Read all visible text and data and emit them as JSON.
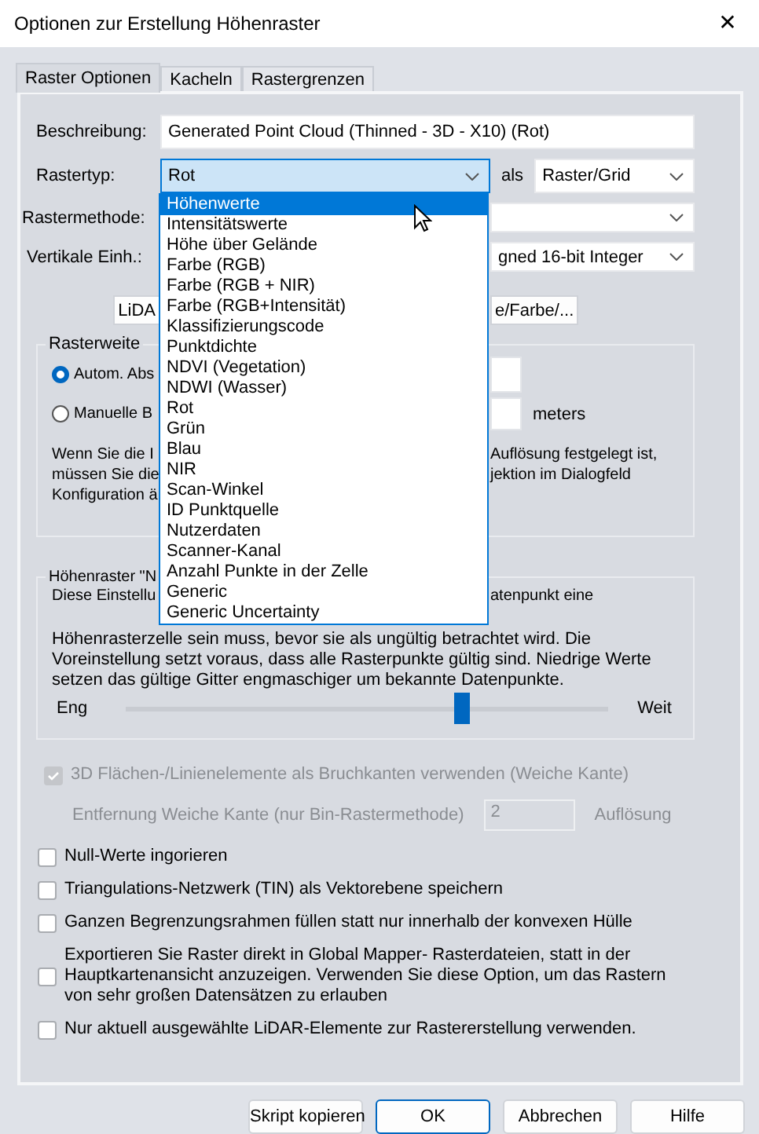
{
  "window": {
    "title": "Optionen zur Erstellung Höhenraster",
    "close": "✕"
  },
  "tabs": [
    {
      "label": "Raster Optionen",
      "selected": true
    },
    {
      "label": "Kacheln",
      "selected": false
    },
    {
      "label": "Rastergrenzen",
      "selected": false
    }
  ],
  "form": {
    "description": {
      "label": "Beschreibung:",
      "value": "Generated Point Cloud (Thinned - 3D - X10) (Rot)"
    },
    "raster_type": {
      "label": "Rastertyp:",
      "value": "Rot",
      "open": true
    },
    "as_label": "als",
    "output_type": {
      "value": "Raster/Grid"
    },
    "method": {
      "label": "Rastermethode:"
    },
    "vertical_units": {
      "label": "Vertikale Einh.:",
      "value": "gned 16-bit Integer"
    }
  },
  "action_buttons": [
    "LiDA",
    "e/Farbe/..."
  ],
  "dropdown": {
    "items": [
      {
        "label": "Höhenwerte",
        "selected": true
      },
      {
        "label": "Intensitätswerte",
        "selected": false
      },
      {
        "label": "Höhe über Gelände",
        "selected": false
      },
      {
        "label": "Farbe (RGB)",
        "selected": false
      },
      {
        "label": "Farbe (RGB + NIR)",
        "selected": false
      },
      {
        "label": "Farbe (RGB+Intensität)",
        "selected": false
      },
      {
        "label": "Klassifizierungscode",
        "selected": false
      },
      {
        "label": "Punktdichte",
        "selected": false
      },
      {
        "label": "NDVI (Vegetation)",
        "selected": false
      },
      {
        "label": "NDWI (Wasser)",
        "selected": false
      },
      {
        "label": "Rot",
        "selected": false
      },
      {
        "label": "Grün",
        "selected": false
      },
      {
        "label": "Blau",
        "selected": false
      },
      {
        "label": "NIR",
        "selected": false
      },
      {
        "label": "Scan-Winkel",
        "selected": false
      },
      {
        "label": "ID Punktquelle",
        "selected": false
      },
      {
        "label": "Nutzerdaten",
        "selected": false
      },
      {
        "label": "Scanner-Kanal",
        "selected": false
      },
      {
        "label": "Anzahl Punkte in der Zelle",
        "selected": false
      },
      {
        "label": "Generic",
        "selected": false
      },
      {
        "label": "Generic Uncertainty",
        "selected": false
      }
    ]
  },
  "spacing": {
    "title": "Rasterweite",
    "options": [
      {
        "label": "Autom. Abs",
        "selected": true
      },
      {
        "label": "Manuelle B",
        "selected": false
      }
    ],
    "unit": "meters",
    "note_lines": [
      {
        "left": "Wenn Sie die I",
        "right": "Auflösung festgelegt ist,"
      },
      {
        "left": "müssen Sie die",
        "right": "jektion im Dialogfeld"
      },
      {
        "left": "Konfiguration ä"
      }
    ]
  },
  "grid": {
    "title": "Höhenraster \"N",
    "lines": [
      {
        "left": "Diese Einstellu",
        "right": "atenpunkt eine"
      },
      {
        "text": "Höhenrasterzelle sein muss, bevor sie als ungültig betrachtet wird. Die"
      },
      {
        "text": "Voreinstellung setzt voraus, dass alle Rasterpunkte gültig sind. Niedrige Werte"
      },
      {
        "text": "setzen das gültige Gitter engmaschiger um bekannte Datenpunkte."
      }
    ],
    "slider": {
      "min_label": "Eng",
      "max_label": "Weit",
      "level": 0.7
    }
  },
  "breaklines": {
    "label": "3D Flächen-/Linienelemente als Bruchkanten verwenden (Weiche Kante)",
    "checked": true,
    "disabled": true
  },
  "soft_edge": {
    "label": "Entfernung Weiche Kante (nur Bin-Rastermethode)",
    "value": "2",
    "unit": "Auflösung",
    "disabled": true
  },
  "options": [
    {
      "label": "Null-Werte ingorieren",
      "checked": false
    },
    {
      "label": "Triangulations-Netzwerk (TIN) als Vektorebene speichern",
      "checked": false
    },
    {
      "label": "Ganzen Begrenzungsrahmen füllen statt nur innerhalb der konvexen Hülle",
      "checked": false
    },
    {
      "label": "Exportieren Sie Raster direkt in Global Mapper- Rasterdateien, statt in der Hauptkartenansicht anzuzeigen. Verwenden Sie diese Option, um das Rastern von sehr großen Datensätzen zu erlauben",
      "checked": false
    },
    {
      "label": "Nur aktuell ausgewählte LiDAR-Elemente zur Rastererstellung verwenden.",
      "checked": false
    }
  ],
  "footer_buttons": [
    {
      "label": "Skript kopieren",
      "default": false
    },
    {
      "label": "OK",
      "default": true
    },
    {
      "label": "Abbrechen",
      "default": false
    },
    {
      "label": "Hilfe",
      "default": false
    }
  ]
}
